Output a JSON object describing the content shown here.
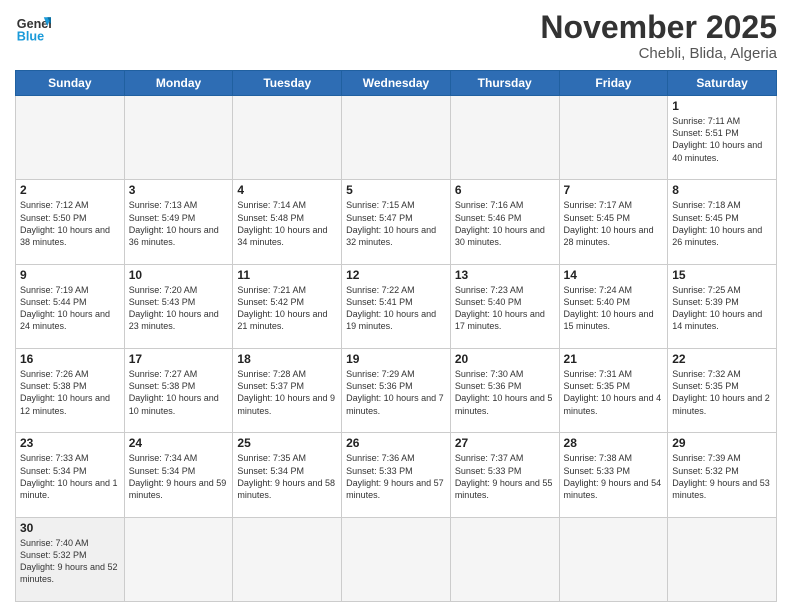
{
  "header": {
    "logo_general": "General",
    "logo_blue": "Blue",
    "month_title": "November 2025",
    "location": "Chebli, Blida, Algeria"
  },
  "weekdays": [
    "Sunday",
    "Monday",
    "Tuesday",
    "Wednesday",
    "Thursday",
    "Friday",
    "Saturday"
  ],
  "days": [
    {
      "day": "",
      "empty": true,
      "sunrise": "",
      "sunset": "",
      "daylight": ""
    },
    {
      "day": "",
      "empty": true,
      "sunrise": "",
      "sunset": "",
      "daylight": ""
    },
    {
      "day": "",
      "empty": true,
      "sunrise": "",
      "sunset": "",
      "daylight": ""
    },
    {
      "day": "",
      "empty": true,
      "sunrise": "",
      "sunset": "",
      "daylight": ""
    },
    {
      "day": "",
      "empty": true,
      "sunrise": "",
      "sunset": "",
      "daylight": ""
    },
    {
      "day": "",
      "empty": true,
      "sunrise": "",
      "sunset": "",
      "daylight": ""
    },
    {
      "day": "1",
      "empty": false,
      "sunrise": "7:11 AM",
      "sunset": "5:51 PM",
      "daylight": "10 hours and 40 minutes."
    },
    {
      "day": "2",
      "empty": false,
      "sunrise": "7:12 AM",
      "sunset": "5:50 PM",
      "daylight": "10 hours and 38 minutes."
    },
    {
      "day": "3",
      "empty": false,
      "sunrise": "7:13 AM",
      "sunset": "5:49 PM",
      "daylight": "10 hours and 36 minutes."
    },
    {
      "day": "4",
      "empty": false,
      "sunrise": "7:14 AM",
      "sunset": "5:48 PM",
      "daylight": "10 hours and 34 minutes."
    },
    {
      "day": "5",
      "empty": false,
      "sunrise": "7:15 AM",
      "sunset": "5:47 PM",
      "daylight": "10 hours and 32 minutes."
    },
    {
      "day": "6",
      "empty": false,
      "sunrise": "7:16 AM",
      "sunset": "5:46 PM",
      "daylight": "10 hours and 30 minutes."
    },
    {
      "day": "7",
      "empty": false,
      "sunrise": "7:17 AM",
      "sunset": "5:45 PM",
      "daylight": "10 hours and 28 minutes."
    },
    {
      "day": "8",
      "empty": false,
      "sunrise": "7:18 AM",
      "sunset": "5:45 PM",
      "daylight": "10 hours and 26 minutes."
    },
    {
      "day": "9",
      "empty": false,
      "sunrise": "7:19 AM",
      "sunset": "5:44 PM",
      "daylight": "10 hours and 24 minutes."
    },
    {
      "day": "10",
      "empty": false,
      "sunrise": "7:20 AM",
      "sunset": "5:43 PM",
      "daylight": "10 hours and 23 minutes."
    },
    {
      "day": "11",
      "empty": false,
      "sunrise": "7:21 AM",
      "sunset": "5:42 PM",
      "daylight": "10 hours and 21 minutes."
    },
    {
      "day": "12",
      "empty": false,
      "sunrise": "7:22 AM",
      "sunset": "5:41 PM",
      "daylight": "10 hours and 19 minutes."
    },
    {
      "day": "13",
      "empty": false,
      "sunrise": "7:23 AM",
      "sunset": "5:40 PM",
      "daylight": "10 hours and 17 minutes."
    },
    {
      "day": "14",
      "empty": false,
      "sunrise": "7:24 AM",
      "sunset": "5:40 PM",
      "daylight": "10 hours and 15 minutes."
    },
    {
      "day": "15",
      "empty": false,
      "sunrise": "7:25 AM",
      "sunset": "5:39 PM",
      "daylight": "10 hours and 14 minutes."
    },
    {
      "day": "16",
      "empty": false,
      "sunrise": "7:26 AM",
      "sunset": "5:38 PM",
      "daylight": "10 hours and 12 minutes."
    },
    {
      "day": "17",
      "empty": false,
      "sunrise": "7:27 AM",
      "sunset": "5:38 PM",
      "daylight": "10 hours and 10 minutes."
    },
    {
      "day": "18",
      "empty": false,
      "sunrise": "7:28 AM",
      "sunset": "5:37 PM",
      "daylight": "10 hours and 9 minutes."
    },
    {
      "day": "19",
      "empty": false,
      "sunrise": "7:29 AM",
      "sunset": "5:36 PM",
      "daylight": "10 hours and 7 minutes."
    },
    {
      "day": "20",
      "empty": false,
      "sunrise": "7:30 AM",
      "sunset": "5:36 PM",
      "daylight": "10 hours and 5 minutes."
    },
    {
      "day": "21",
      "empty": false,
      "sunrise": "7:31 AM",
      "sunset": "5:35 PM",
      "daylight": "10 hours and 4 minutes."
    },
    {
      "day": "22",
      "empty": false,
      "sunrise": "7:32 AM",
      "sunset": "5:35 PM",
      "daylight": "10 hours and 2 minutes."
    },
    {
      "day": "23",
      "empty": false,
      "sunrise": "7:33 AM",
      "sunset": "5:34 PM",
      "daylight": "10 hours and 1 minute."
    },
    {
      "day": "24",
      "empty": false,
      "sunrise": "7:34 AM",
      "sunset": "5:34 PM",
      "daylight": "9 hours and 59 minutes."
    },
    {
      "day": "25",
      "empty": false,
      "sunrise": "7:35 AM",
      "sunset": "5:34 PM",
      "daylight": "9 hours and 58 minutes."
    },
    {
      "day": "26",
      "empty": false,
      "sunrise": "7:36 AM",
      "sunset": "5:33 PM",
      "daylight": "9 hours and 57 minutes."
    },
    {
      "day": "27",
      "empty": false,
      "sunrise": "7:37 AM",
      "sunset": "5:33 PM",
      "daylight": "9 hours and 55 minutes."
    },
    {
      "day": "28",
      "empty": false,
      "sunrise": "7:38 AM",
      "sunset": "5:33 PM",
      "daylight": "9 hours and 54 minutes."
    },
    {
      "day": "29",
      "empty": false,
      "sunrise": "7:39 AM",
      "sunset": "5:32 PM",
      "daylight": "9 hours and 53 minutes."
    },
    {
      "day": "30",
      "empty": false,
      "sunrise": "7:40 AM",
      "sunset": "5:32 PM",
      "daylight": "9 hours and 52 minutes."
    },
    {
      "day": "",
      "empty": true,
      "sunrise": "",
      "sunset": "",
      "daylight": ""
    },
    {
      "day": "",
      "empty": true,
      "sunrise": "",
      "sunset": "",
      "daylight": ""
    },
    {
      "day": "",
      "empty": true,
      "sunrise": "",
      "sunset": "",
      "daylight": ""
    },
    {
      "day": "",
      "empty": true,
      "sunrise": "",
      "sunset": "",
      "daylight": ""
    },
    {
      "day": "",
      "empty": true,
      "sunrise": "",
      "sunset": "",
      "daylight": ""
    },
    {
      "day": "",
      "empty": true,
      "sunrise": "",
      "sunset": "",
      "daylight": ""
    }
  ]
}
